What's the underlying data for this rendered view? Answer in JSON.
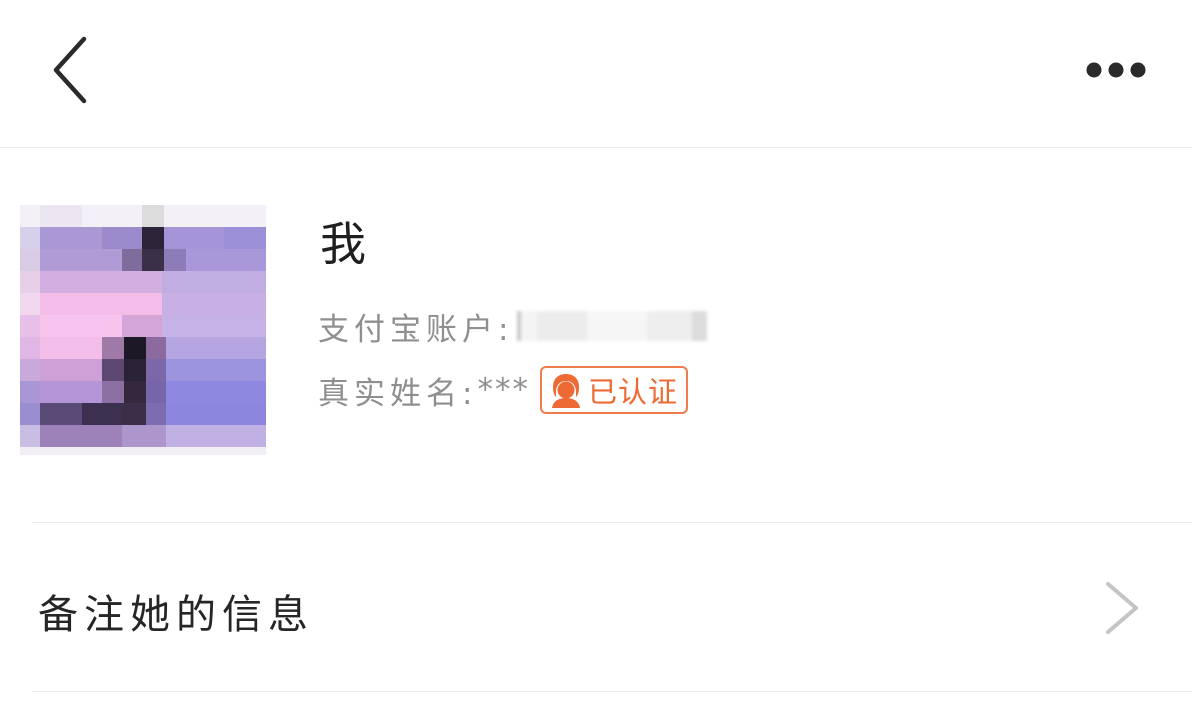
{
  "nav": {
    "back_icon": "chevron-left-icon",
    "more_icon": "more-dots-icon"
  },
  "profile": {
    "name": "我",
    "account_label": "支付宝账户:",
    "account_value_masked": true,
    "realname_label": "真实姓名:",
    "realname_value": "***",
    "verified_label": "已认证",
    "verified_color": "#ee6a34"
  },
  "remark": {
    "label": "备注她的信息",
    "icon": "chevron-right-icon"
  }
}
